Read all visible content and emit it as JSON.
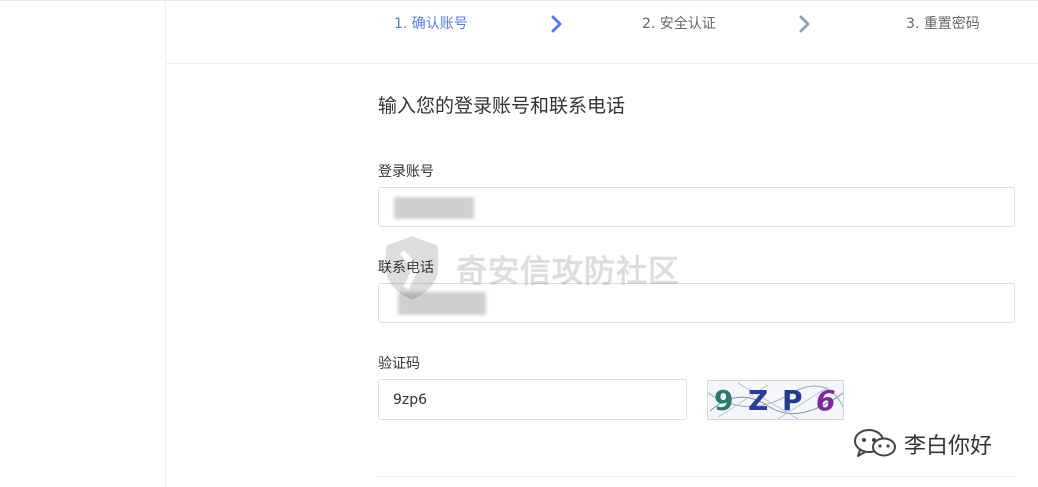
{
  "steps": [
    {
      "label": "1. 确认账号",
      "active": true
    },
    {
      "label": "2. 安全认证",
      "active": false
    },
    {
      "label": "3. 重置密码",
      "active": false
    }
  ],
  "colors": {
    "accent": "#5b7ce6",
    "chevron_inactive": "#9aa0b4",
    "border": "#dcdfe6"
  },
  "form": {
    "title": "输入您的登录账号和联系电话",
    "account_label": "登录账号",
    "account_value": "",
    "phone_label": "联系电话",
    "phone_value": "",
    "captcha_label": "验证码",
    "captcha_value": "9zp6",
    "captcha_image_chars": [
      "9",
      "Z",
      "P",
      "6"
    ]
  },
  "watermark": {
    "text": "奇安信攻防社区"
  },
  "wechat": {
    "name": "李白你好",
    "icon": "wechat-icon"
  }
}
